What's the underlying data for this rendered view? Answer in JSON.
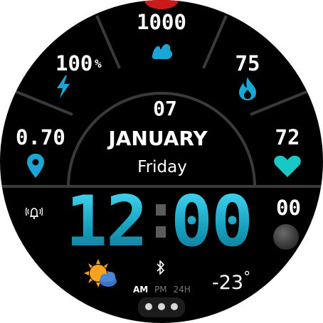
{
  "steps": {
    "value": "1000",
    "icon": "running-shoe-icon"
  },
  "battery": {
    "value": "100",
    "unit": "%",
    "icon": "lightning-bolt-icon"
  },
  "calories": {
    "value": "75",
    "icon": "flame-icon"
  },
  "distance": {
    "value": "0.70",
    "icon": "location-pin-icon"
  },
  "heart_rate": {
    "value": "72",
    "icon": "heart-icon"
  },
  "date": {
    "day": "07",
    "month": "JANUARY",
    "weekday": "Friday"
  },
  "time": {
    "hours": "12",
    "minutes": "00",
    "seconds": "00"
  },
  "alarm": {
    "icon": "alarm-bell-icon"
  },
  "moon": {
    "icon": "moon-phase-icon"
  },
  "weather": {
    "icon": "sun-cloud-icon",
    "temperature": "-23",
    "unit": "°"
  },
  "bluetooth": {
    "icon": "bluetooth-icon"
  },
  "time_format": {
    "am": "AM",
    "pm": "PM",
    "h24": "24H"
  },
  "pager": {
    "icon": "more-dots-icon"
  },
  "colors": {
    "accent": "#1aa7d8",
    "heart": "#19c7c7",
    "digits": "#22b3cf",
    "arc": "#3a3a3a",
    "red_top": "#cc1a1a"
  }
}
